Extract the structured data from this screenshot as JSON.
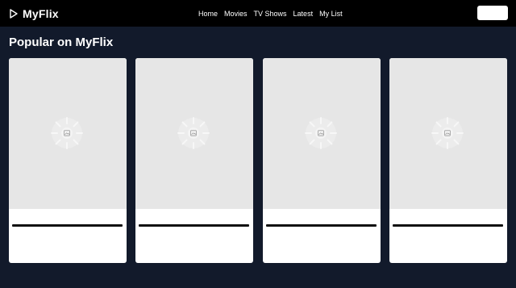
{
  "brand": {
    "name": "MyFlix",
    "icon": "play-icon"
  },
  "nav": [
    {
      "label": "Home"
    },
    {
      "label": "Movies"
    },
    {
      "label": "TV Shows"
    },
    {
      "label": "Latest"
    },
    {
      "label": "My List"
    }
  ],
  "section": {
    "title": "Popular on MyFlix"
  },
  "cards": [
    {
      "poster_icon": "image-placeholder-icon"
    },
    {
      "poster_icon": "image-placeholder-icon"
    },
    {
      "poster_icon": "image-placeholder-icon"
    },
    {
      "poster_icon": "image-placeholder-icon"
    }
  ],
  "colors": {
    "page_background": "#121a2b",
    "topbar": "#000000",
    "poster_placeholder": "#e6e6e6",
    "card": "#ffffff"
  }
}
